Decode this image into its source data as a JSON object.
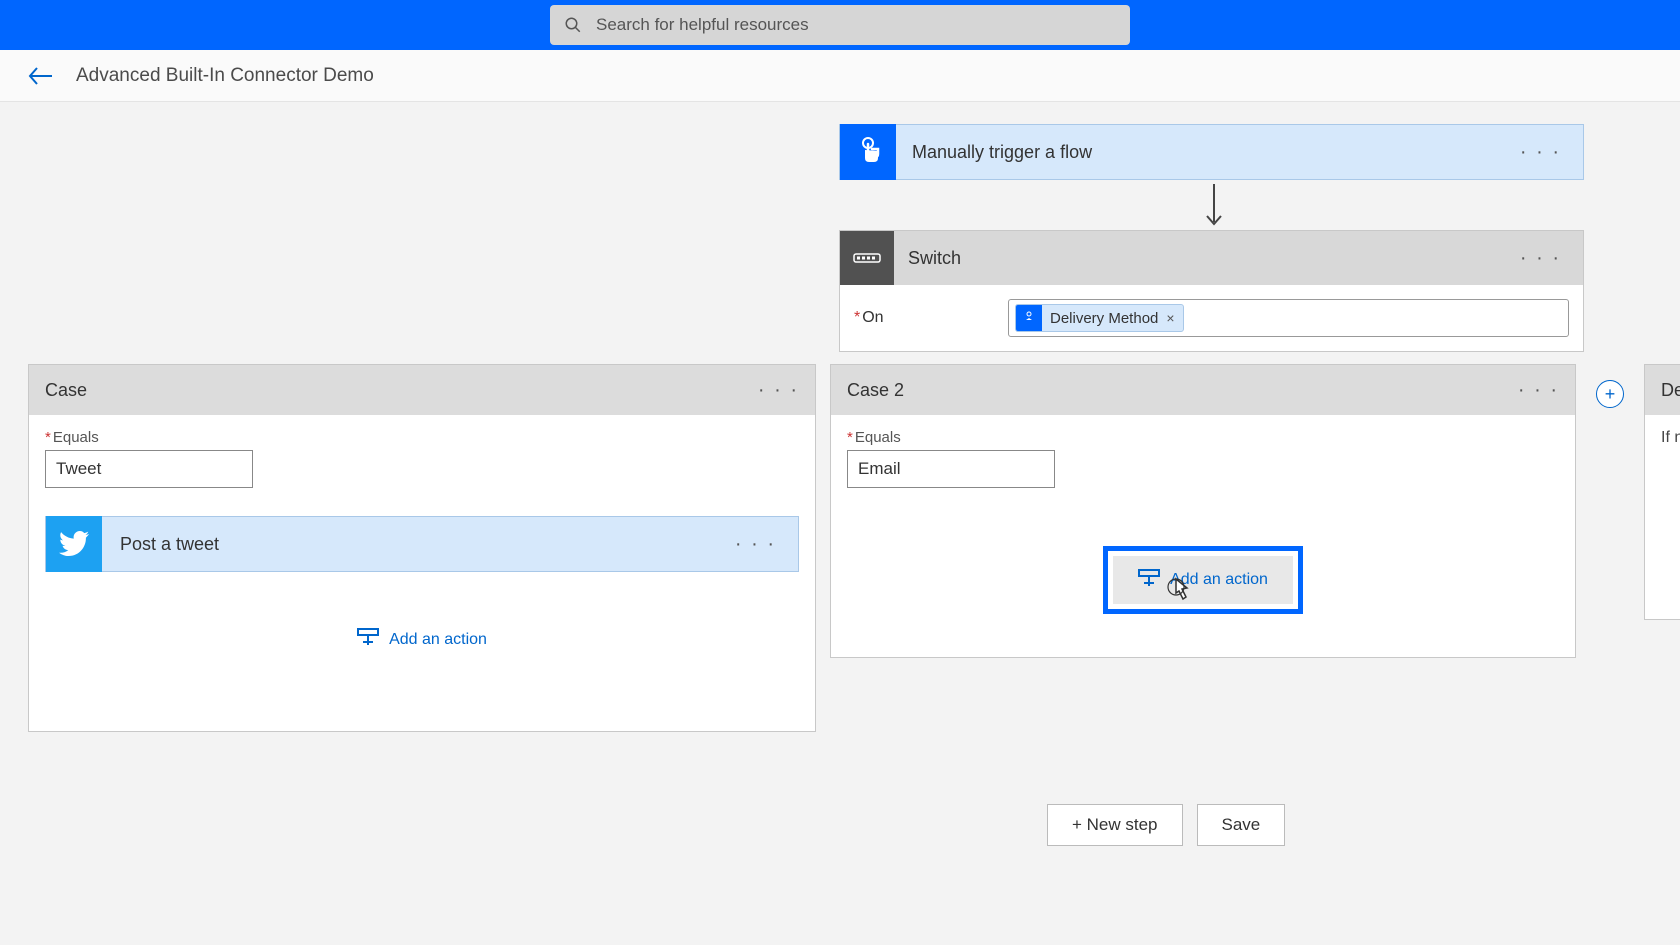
{
  "search": {
    "placeholder": "Search for helpful resources"
  },
  "page_title": "Advanced Built-In Connector Demo",
  "trigger": {
    "label": "Manually trigger a flow"
  },
  "switch": {
    "title": "Switch",
    "on_label": "On",
    "token_label": "Delivery Method"
  },
  "case1": {
    "title": "Case",
    "equals_label": "Equals",
    "equals_value": "Tweet",
    "action_label": "Post a tweet",
    "add_action": "Add an action"
  },
  "case2": {
    "title": "Case 2",
    "equals_label": "Equals",
    "equals_value": "Email",
    "add_action": "Add an action"
  },
  "default_card": {
    "title": "Default",
    "body": "If no"
  },
  "buttons": {
    "new_step": "+ New step",
    "save": "Save"
  }
}
